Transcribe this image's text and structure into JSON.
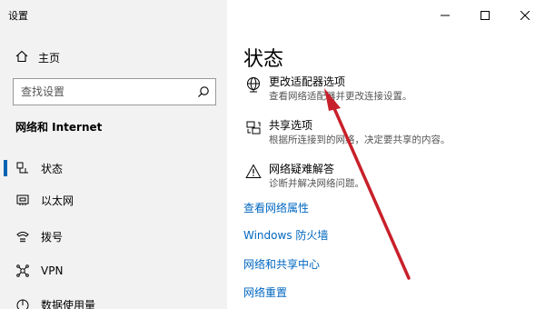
{
  "app": {
    "title": "设置"
  },
  "sidebar": {
    "home_label": "主页",
    "search_placeholder": "查找设置",
    "section_title": "网络和 Internet",
    "items": [
      {
        "label": "状态",
        "icon": "status-icon",
        "active": true
      },
      {
        "label": "以太网",
        "icon": "ethernet-icon",
        "active": false
      },
      {
        "label": "拨号",
        "icon": "dialup-icon",
        "active": false
      },
      {
        "label": "VPN",
        "icon": "vpn-icon",
        "active": false
      },
      {
        "label": "数据使用量",
        "icon": "data-usage-icon",
        "active": false
      }
    ]
  },
  "main": {
    "title": "状态",
    "options": [
      {
        "title": "更改适配器选项",
        "desc": "查看网络适配器并更改连接设置。",
        "icon": "globe-icon"
      },
      {
        "title": "共享选项",
        "desc": "根据所连接到的网络，决定要共享的内容。",
        "icon": "sharing-icon"
      },
      {
        "title": "网络疑难解答",
        "desc": "诊断并解决网络问题。",
        "icon": "warning-icon"
      }
    ],
    "links": [
      "查看网络属性",
      "Windows 防火墙",
      "网络和共享中心",
      "网络重置"
    ]
  },
  "colors": {
    "accent": "#0063b1",
    "link": "#0067c0",
    "arrow": "#c8202a",
    "sidebar_bg": "#f2f2f2"
  }
}
